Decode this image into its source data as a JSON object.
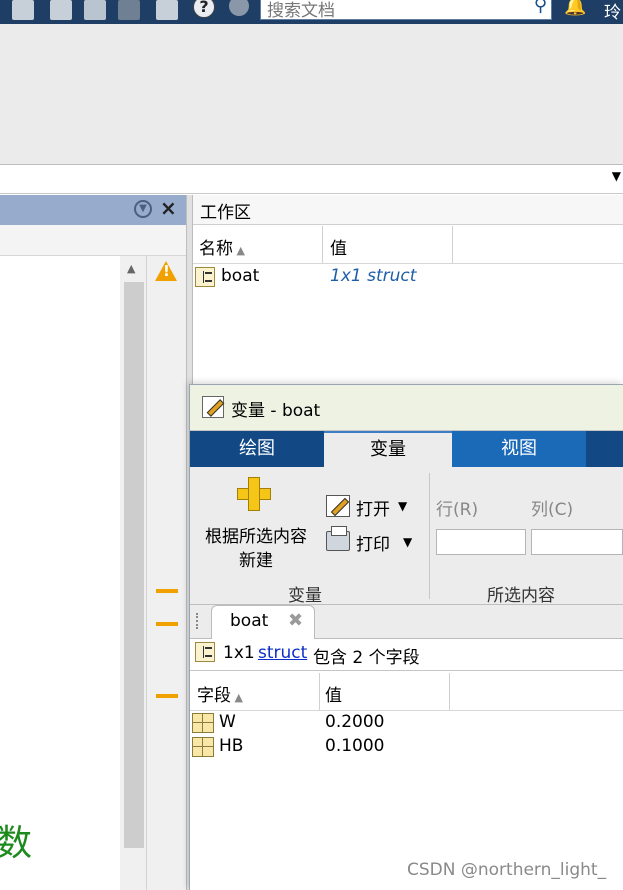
{
  "toolbar": {
    "search_placeholder": "搜索文档",
    "help_symbol": "?",
    "user_name": "玲"
  },
  "command_window": {
    "partial_text": "数"
  },
  "workspace": {
    "title": "工作区",
    "col_name": "名称",
    "col_value": "值",
    "rows": [
      {
        "name": "boat",
        "value": "1x1 struct"
      }
    ]
  },
  "variables_editor": {
    "title": "变量 - boat",
    "tabs": [
      "绘图",
      "变量",
      "视图"
    ],
    "new_from_selection": [
      "根据所选内容",
      "新建"
    ],
    "open_label": "打开",
    "print_label": "打印",
    "section_variable": "变量",
    "row_label": "行(R)",
    "col_label": "列(C)",
    "section_selection": "所选内容",
    "doc_tab": "boat",
    "struct_info": {
      "size": "1x1",
      "link": "struct",
      "rest": "包含 2 个字段"
    },
    "field_col_name": "字段",
    "field_col_value": "值",
    "fields": [
      {
        "name": "W",
        "value": "0.2000"
      },
      {
        "name": "HB",
        "value": "0.1000"
      }
    ]
  },
  "watermark": "CSDN @northern_light_",
  "colors": {
    "accent_blue": "#124984",
    "warning": "#f0a000",
    "command_green": "#1c8a1c",
    "struct_value": "#1f5fa8"
  }
}
